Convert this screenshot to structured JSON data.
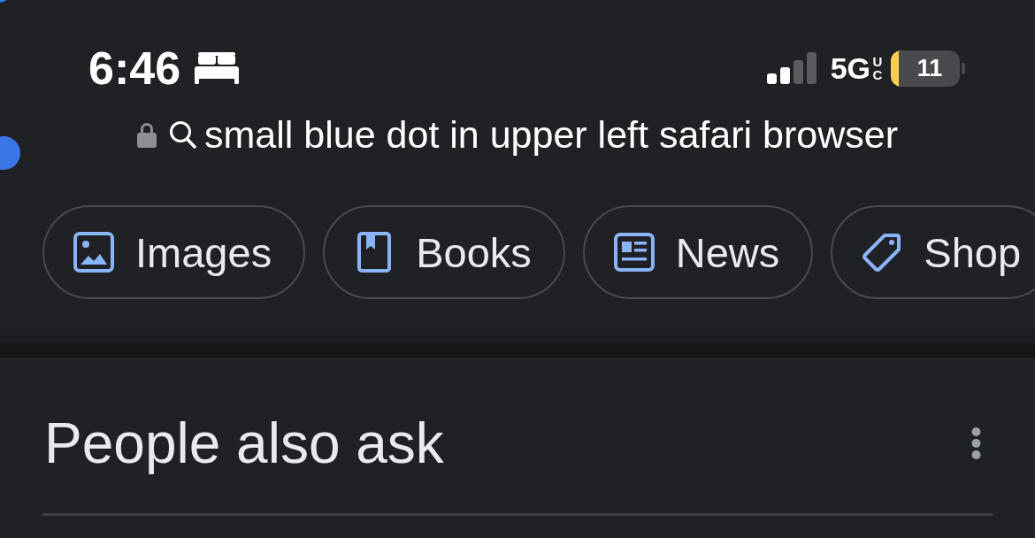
{
  "status_bar": {
    "time": "6:46",
    "network": "5G",
    "network_suffix": "UC",
    "battery": "11"
  },
  "address_bar": {
    "query": "small blue dot in upper left safari browser"
  },
  "chips": [
    {
      "label": "Images",
      "kind": "images"
    },
    {
      "label": "Books",
      "kind": "books"
    },
    {
      "label": "News",
      "kind": "news"
    },
    {
      "label": "Shop",
      "kind": "tag"
    }
  ],
  "section": {
    "title": "People also ask"
  }
}
